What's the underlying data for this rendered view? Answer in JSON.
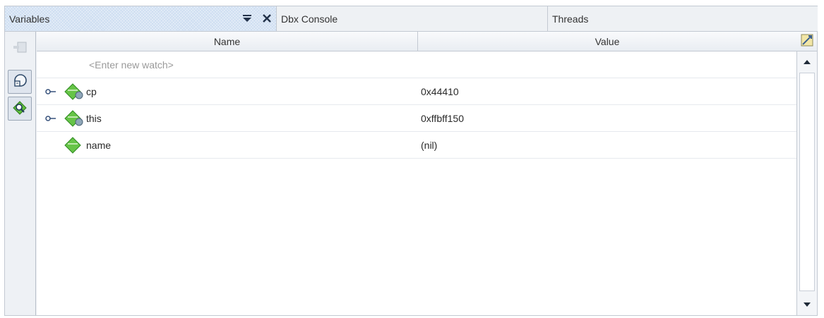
{
  "tabs": [
    {
      "label": "Variables",
      "active": true
    },
    {
      "label": "Dbx Console",
      "active": false
    },
    {
      "label": "Threads",
      "active": false
    }
  ],
  "table": {
    "columns": {
      "name": "Name",
      "value": "Value"
    },
    "new_watch_placeholder": "<Enter new watch>",
    "rows": [
      {
        "name": "cp",
        "value": "0x44410",
        "expandable": true
      },
      {
        "name": "this",
        "value": "0xffbff150",
        "expandable": true
      },
      {
        "name": "name",
        "value": "(nil)",
        "expandable": false
      }
    ]
  },
  "icons": {
    "tab_dropdown": "dropdown-arrow-icon",
    "tab_close": "close-icon",
    "left_tools": [
      "new-watch-icon",
      "local-variables-icon",
      "watch-variables-icon"
    ],
    "corner": "column-chooser-icon",
    "variable": "green-diamond-variable-icon",
    "expander": "expand-key-icon"
  },
  "colors": {
    "active_tab": "#cdddf1",
    "variable_icon": "#5fbf3c"
  }
}
